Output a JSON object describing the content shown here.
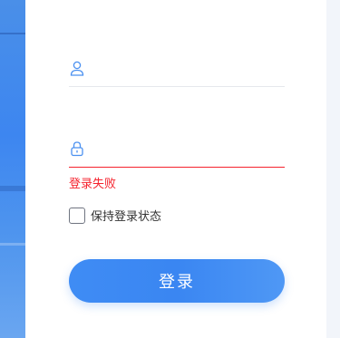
{
  "form": {
    "username": {
      "value": "",
      "icon": "user-icon"
    },
    "password": {
      "value": "",
      "icon": "lock-icon"
    },
    "error_message": "登录失败",
    "remember_label": "保持登录状态",
    "remember_checked": false,
    "submit_label": "登录"
  },
  "colors": {
    "accent": "#3f8cf4",
    "error": "#f5222d",
    "icon": "#4a90f0"
  }
}
